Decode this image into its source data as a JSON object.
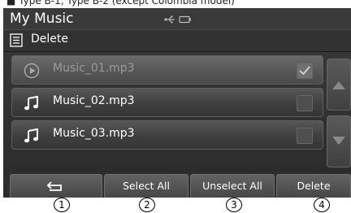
{
  "caption": {
    "text": "■ Type B-1, Type B-2 (except Colombia model)"
  },
  "header": {
    "title": "My Music",
    "status_icons": [
      "usb-icon",
      "battery-icon"
    ]
  },
  "menu": {
    "label": "Delete",
    "icon": "menu-list-icon"
  },
  "tracks": [
    {
      "name": "Music_01.mp3",
      "icon": "play-circle-icon",
      "checked": true
    },
    {
      "name": "Music_02.mp3",
      "icon": "music-note-icon",
      "checked": false
    },
    {
      "name": "Music_03.mp3",
      "icon": "music-note-icon",
      "checked": false
    }
  ],
  "scroll": {
    "up_icon": "up-arrow-icon",
    "down_icon": "down-arrow-icon"
  },
  "buttons": {
    "back_icon": "back-arrow-icon",
    "select_all": "Select All",
    "unselect_all": "Unselect All",
    "delete": "Delete"
  },
  "callouts": [
    "1",
    "2",
    "3",
    "4"
  ]
}
